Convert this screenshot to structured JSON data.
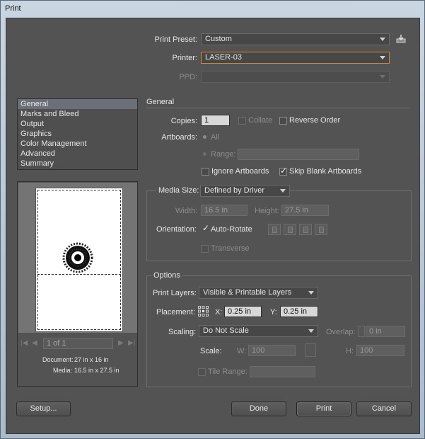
{
  "window": {
    "title": "Print"
  },
  "print_preset": {
    "label": "Print Preset:",
    "value": "Custom"
  },
  "printer": {
    "label": "Printer:",
    "value": "LASER-03"
  },
  "ppd": {
    "label": "PPD:",
    "value": ""
  },
  "categories": [
    {
      "label": "General",
      "selected": true
    },
    {
      "label": "Marks and Bleed",
      "selected": false
    },
    {
      "label": "Output",
      "selected": false
    },
    {
      "label": "Graphics",
      "selected": false
    },
    {
      "label": "Color Management",
      "selected": false
    },
    {
      "label": "Advanced",
      "selected": false
    },
    {
      "label": "Summary",
      "selected": false
    }
  ],
  "general": {
    "heading": "General",
    "copies_label": "Copies:",
    "copies_value": "1",
    "collate_label": "Collate",
    "reverse_order_label": "Reverse Order",
    "artboards_label": "Artboards:",
    "all_label": "All",
    "range_label": "Range:",
    "range_value": "",
    "ignore_artboards_label": "Ignore Artboards",
    "skip_blank_label": "Skip Blank Artboards",
    "skip_blank_checked": true,
    "ignore_artboards_checked": false
  },
  "media": {
    "group_label": "Media Size:",
    "size_value": "Defined by Driver",
    "width_label": "Width:",
    "width_value": "16.5 in",
    "height_label": "Height:",
    "height_value": "27.5 in",
    "orientation_label": "Orientation:",
    "auto_rotate_label": "Auto-Rotate",
    "auto_rotate_checked": true,
    "transverse_label": "Transverse"
  },
  "options": {
    "group_label": "Options",
    "print_layers_label": "Print Layers:",
    "print_layers_value": "Visible & Printable Layers",
    "placement_label": "Placement:",
    "x_label": "X:",
    "x_value": "0.25 in",
    "y_label": "Y:",
    "y_value": "0.25 in",
    "scaling_label": "Scaling:",
    "scaling_value": "Do Not Scale",
    "overlap_label": "Overlap:",
    "overlap_value": "0 in",
    "scale_label": "Scale:",
    "w_label": "W:",
    "w_value": "100",
    "h_label": "H:",
    "h_value": "100",
    "tile_range_label": "Tile Range:",
    "tile_range_value": ""
  },
  "preview": {
    "page_value": "1 of 1",
    "document_label": "Document:",
    "document_value": "27 in x 16 in",
    "media_label": "Media:",
    "media_value": "16.5 in x 27.5 in"
  },
  "buttons": {
    "setup": "Setup...",
    "done": "Done",
    "print": "Print",
    "cancel": "Cancel"
  },
  "colors": {
    "dialog_bg": "#535353",
    "focus_border": "#d08a2e",
    "selection": "#6b6f78"
  }
}
